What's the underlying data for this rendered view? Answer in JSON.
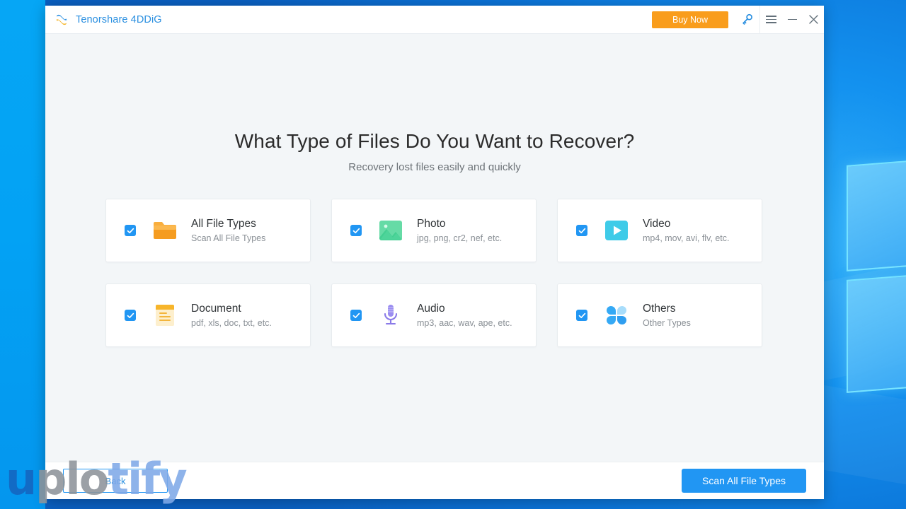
{
  "window": {
    "app_title": "Tenorshare 4DDiG",
    "logo_icon": "tenorshare-logo-icon",
    "titlebar": {
      "buy_now_label": "Buy Now",
      "buy_now_color": "#f99d1c",
      "key_icon": "key-icon",
      "menu_icon": "hamburger-menu-icon",
      "minimize_icon": "minimize-icon",
      "close_icon": "close-icon"
    }
  },
  "main": {
    "title": "What Type of Files Do You Want to Recover?",
    "subtitle": "Recovery lost files easily and quickly",
    "cards": [
      {
        "name": "All File Types",
        "desc": "Scan All File Types",
        "icon": "folder-icon",
        "checked": true,
        "color": "#f5a623"
      },
      {
        "name": "Photo",
        "desc": "jpg, png, cr2, nef, etc.",
        "icon": "photo-icon",
        "checked": true,
        "color": "#5fd8a4"
      },
      {
        "name": "Video",
        "desc": "mp4, mov, avi, flv, etc.",
        "icon": "video-icon",
        "checked": true,
        "color": "#45c8e8"
      },
      {
        "name": "Document",
        "desc": "pdf, xls, doc, txt, etc.",
        "icon": "document-icon",
        "checked": true,
        "color": "#f6b22a"
      },
      {
        "name": "Audio",
        "desc": "mp3, aac, wav, ape, etc.",
        "icon": "microphone-icon",
        "checked": true,
        "color": "#8b7ae8"
      },
      {
        "name": "Others",
        "desc": "Other Types",
        "icon": "others-clover-icon",
        "checked": true,
        "color": "#35a9f5"
      }
    ]
  },
  "footer": {
    "back_label": "Back",
    "scan_label": "Scan All File Types",
    "accent_color": "#2196f3"
  },
  "watermark": {
    "part1": "u",
    "part2": "plo",
    "part3": "tify"
  }
}
